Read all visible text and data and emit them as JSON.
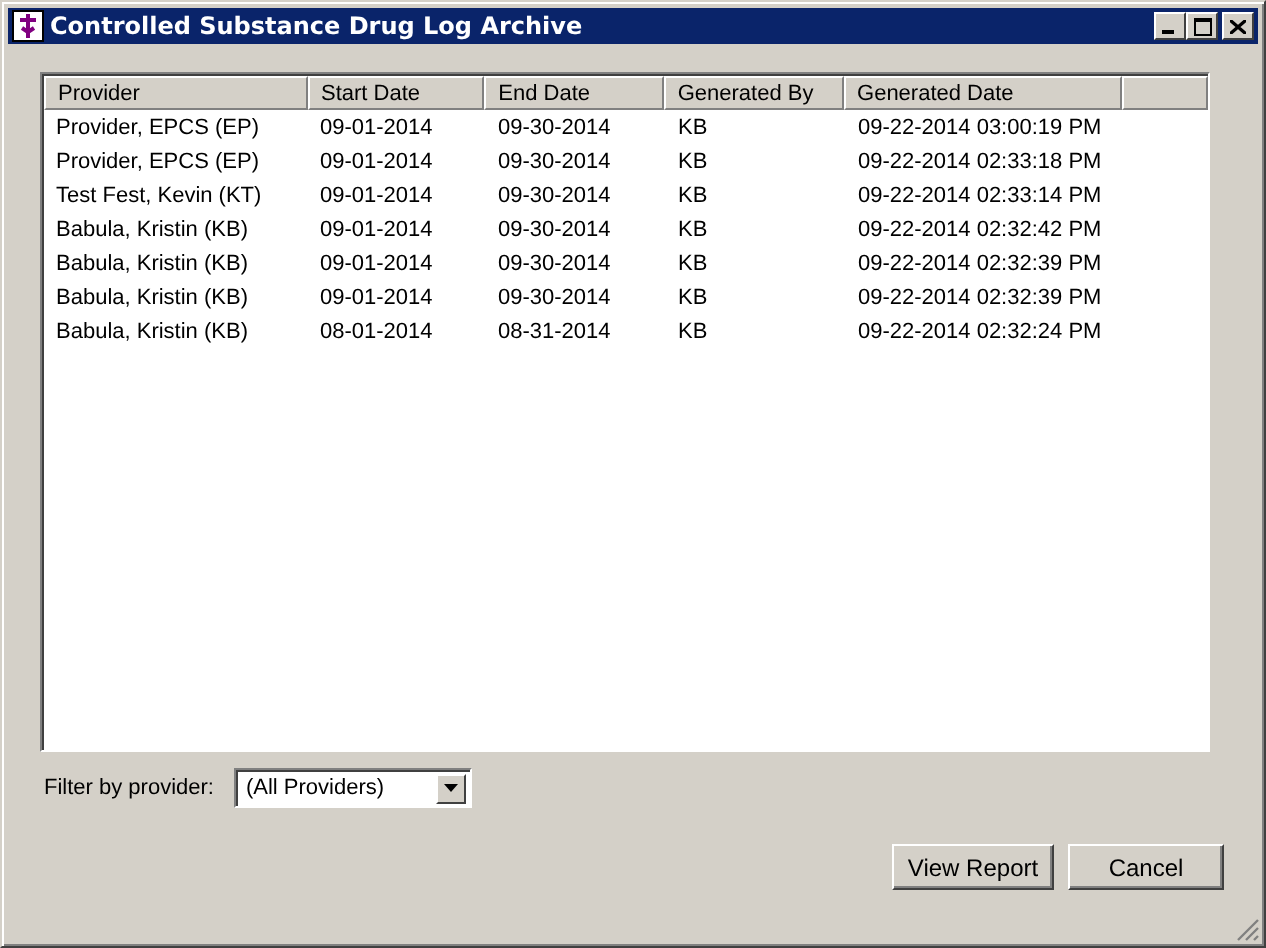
{
  "window": {
    "title": "Controlled Substance Drug Log Archive"
  },
  "table": {
    "columns": [
      "Provider",
      "Start Date",
      "End Date",
      "Generated By",
      "Generated Date"
    ],
    "rows": [
      [
        "Provider, EPCS (EP)",
        "09-01-2014",
        "09-30-2014",
        "KB",
        "09-22-2014 03:00:19 PM"
      ],
      [
        "Provider, EPCS (EP)",
        "09-01-2014",
        "09-30-2014",
        "KB",
        "09-22-2014 02:33:18 PM"
      ],
      [
        "Test Fest, Kevin (KT)",
        "09-01-2014",
        "09-30-2014",
        "KB",
        "09-22-2014 02:33:14 PM"
      ],
      [
        "Babula, Kristin (KB)",
        "09-01-2014",
        "09-30-2014",
        "KB",
        "09-22-2014 02:32:42 PM"
      ],
      [
        "Babula, Kristin (KB)",
        "09-01-2014",
        "09-30-2014",
        "KB",
        "09-22-2014 02:32:39 PM"
      ],
      [
        "Babula, Kristin (KB)",
        "09-01-2014",
        "09-30-2014",
        "KB",
        "09-22-2014 02:32:39 PM"
      ],
      [
        "Babula, Kristin (KB)",
        "08-01-2014",
        "08-31-2014",
        "KB",
        "09-22-2014 02:32:24 PM"
      ]
    ]
  },
  "filter": {
    "label": "Filter by provider:",
    "value": "(All Providers)"
  },
  "buttons": [
    "View Report",
    "Cancel"
  ]
}
